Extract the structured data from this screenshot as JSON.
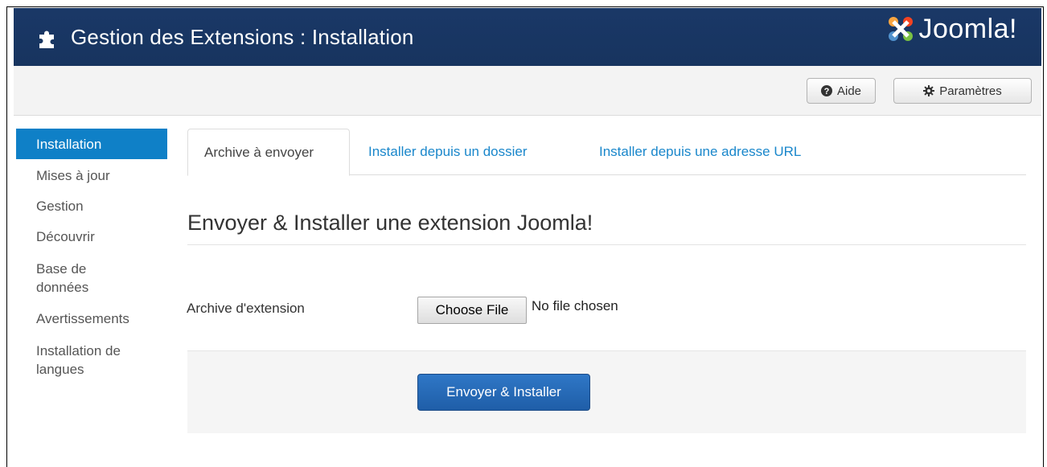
{
  "header": {
    "title": "Gestion des Extensions : Installation",
    "logo_text": "Joomla!"
  },
  "toolbar": {
    "help_label": "Aide",
    "settings_label": "Paramètres"
  },
  "sidebar": {
    "items": [
      {
        "label": "Installation",
        "active": true
      },
      {
        "label": "Mises à jour"
      },
      {
        "label": "Gestion"
      },
      {
        "label": "Découvrir"
      },
      {
        "label": "Base de données"
      },
      {
        "label": "Avertissements"
      },
      {
        "label": "Installation de langues"
      }
    ]
  },
  "tabs": [
    {
      "label": "Archive à envoyer",
      "active": true
    },
    {
      "label": "Installer depuis un dossier"
    },
    {
      "label": "Installer depuis une adresse URL"
    }
  ],
  "main": {
    "heading": "Envoyer & Installer une extension Joomla!",
    "field_label": "Archive d'extension",
    "file_button": "Choose File",
    "file_status": "No file chosen",
    "submit_label": "Envoyer & Installer"
  },
  "colors": {
    "header_bg": "#17345f",
    "accent": "#0f80c7",
    "link": "#1a87cb",
    "primary_button": "#2466b3"
  }
}
